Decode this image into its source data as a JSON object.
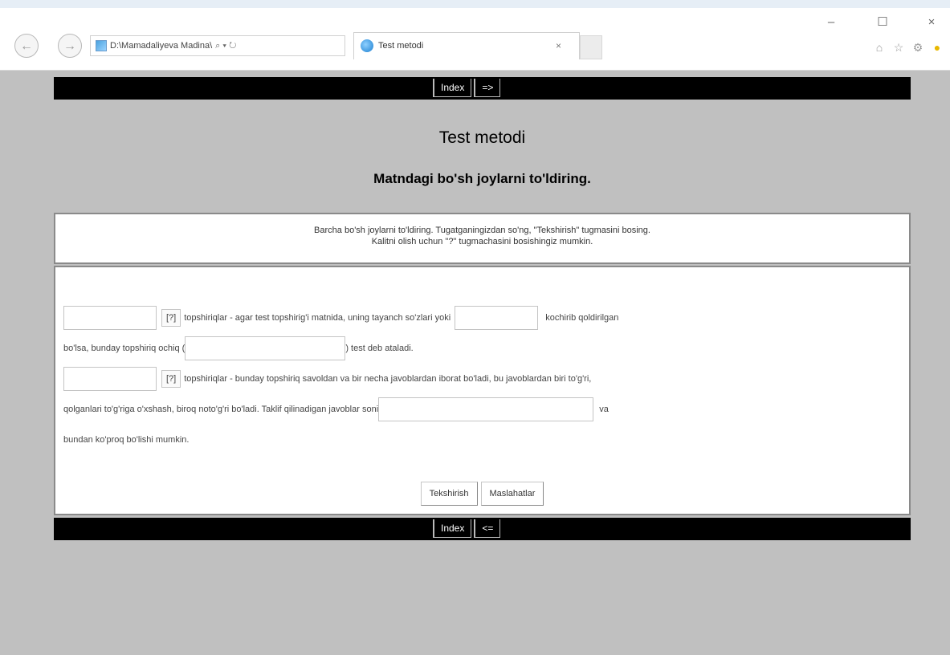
{
  "browser": {
    "address": "D:\\Mamadaliyeva Madina\\",
    "address_controls": "⌕ ▾ ↻",
    "tab_title": "Test metodi",
    "tab_close": "×",
    "window": {
      "minimize": "–",
      "maximize": "☐",
      "close": "×"
    },
    "tools": {
      "home": "⌂",
      "favorites": "☆",
      "settings": "⚙"
    }
  },
  "nav_top": {
    "index_label": "Index",
    "next_label": "=>"
  },
  "nav_bottom": {
    "index_label": "Index",
    "prev_label": "<="
  },
  "page": {
    "title": "Test metodi",
    "subtitle": "Matndagi bo'sh joylarni to'ldiring."
  },
  "instructions": {
    "line1": "Barcha bo'sh joylarni to'ldiring. Tugatganingizdan so'ng, \"Tekshirish\" tugmasini bosing.",
    "line2": "Kalitni olish uchun \"?\" tugmachasini bosishingiz mumkin."
  },
  "exercise": {
    "hint_label": "[?]",
    "seg1": "topshiriqlar - agar test topshirig'i matnida, uning tayanch so'zlari yoki",
    "seg2": "kochirib qoldirilgan",
    "seg3": "bo'lsa, bunday topshiriq ochiq (",
    "seg4": ") test deb ataladi.",
    "seg5": "topshiriqlar - bunday topshiriq savoldan va bir necha javoblardan iborat bo'ladi, bu javoblardan biri to'g'ri,",
    "seg6": "qolganlari to'g'riga o'xshash, biroq noto'g'ri bo'ladi. Taklif qilinadigan javoblar soni",
    "seg7": "va",
    "seg8": "bundan ko'proq bo'lishi mumkin."
  },
  "buttons": {
    "check": "Tekshirish",
    "answers": "Maslahatlar"
  }
}
